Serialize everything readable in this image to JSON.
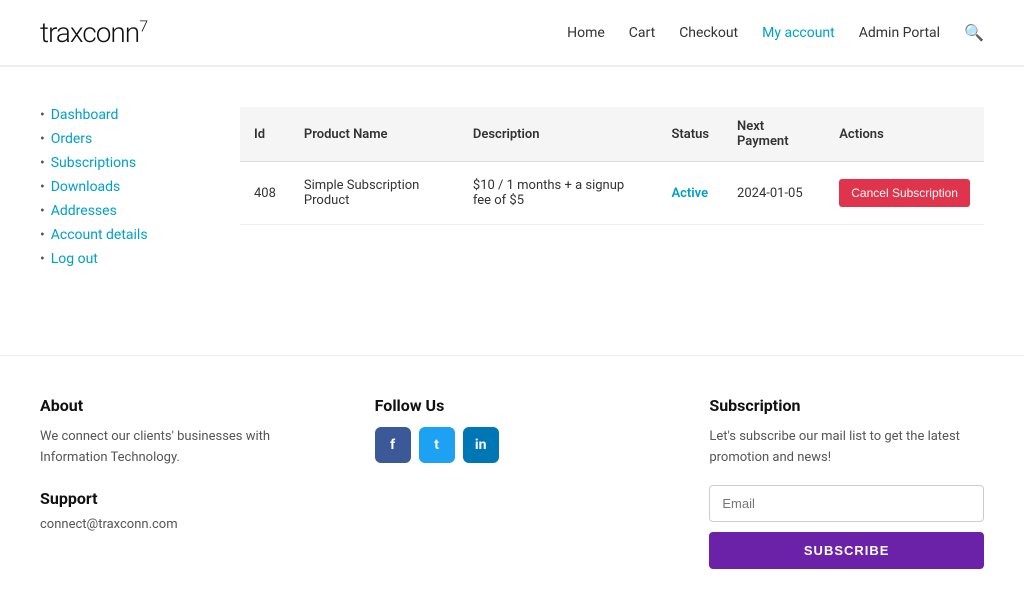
{
  "header": {
    "logo": "traxconn",
    "logo_sup": "7",
    "nav": {
      "home": "Home",
      "cart": "Cart",
      "checkout": "Checkout",
      "my_account": "My account",
      "admin_portal": "Admin Portal"
    }
  },
  "sidebar": {
    "items": [
      {
        "label": "Dashboard",
        "href": "#"
      },
      {
        "label": "Orders",
        "href": "#"
      },
      {
        "label": "Subscriptions",
        "href": "#"
      },
      {
        "label": "Downloads",
        "href": "#"
      },
      {
        "label": "Addresses",
        "href": "#"
      },
      {
        "label": "Account details",
        "href": "#"
      },
      {
        "label": "Log out",
        "href": "#"
      }
    ]
  },
  "table": {
    "columns": [
      {
        "key": "id",
        "label": "Id"
      },
      {
        "key": "product_name",
        "label": "Product Name"
      },
      {
        "key": "description",
        "label": "Description"
      },
      {
        "key": "status",
        "label": "Status"
      },
      {
        "key": "next_payment",
        "label": "Next Payment"
      },
      {
        "key": "actions",
        "label": "Actions"
      }
    ],
    "rows": [
      {
        "id": "408",
        "product_name": "Simple Subscription Product",
        "description": "$10 / 1 months + a signup fee of $5",
        "status": "Active",
        "next_payment": "2024-01-05",
        "action_label": "Cancel Subscription"
      }
    ]
  },
  "footer": {
    "about": {
      "title": "About",
      "text": "We connect our clients' businesses with Information Technology."
    },
    "support": {
      "title": "Support",
      "email": "connect@traxconn.com"
    },
    "follow": {
      "title": "Follow Us",
      "icons": [
        {
          "name": "facebook",
          "symbol": "f"
        },
        {
          "name": "twitter",
          "symbol": "t"
        },
        {
          "name": "linkedin",
          "symbol": "in"
        }
      ]
    },
    "subscription": {
      "title": "Subscription",
      "text": "Let's subscribe our mail list to get the latest promotion and news!",
      "email_placeholder": "Email",
      "subscribe_label": "SUBSCRIBE"
    }
  }
}
